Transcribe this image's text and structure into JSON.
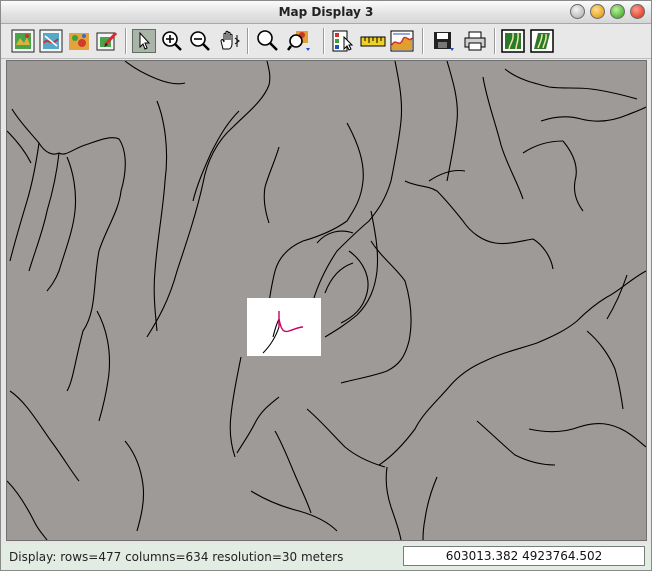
{
  "window": {
    "title": "Map Display 3"
  },
  "toolbar": {
    "buttons": [
      {
        "name": "display-raster-map-icon"
      },
      {
        "name": "display-vector-map-icon"
      },
      {
        "name": "display-shaded-relief-icon"
      },
      {
        "name": "overlay-icon"
      },
      {
        "name": "pointer-icon"
      },
      {
        "name": "zoom-in-icon"
      },
      {
        "name": "zoom-out-icon"
      },
      {
        "name": "pan-icon"
      },
      {
        "name": "zoom-menu-icon"
      },
      {
        "name": "query-icon"
      },
      {
        "name": "layer-legend-icon"
      },
      {
        "name": "measure-icon"
      },
      {
        "name": "profile-icon"
      },
      {
        "name": "save-icon"
      },
      {
        "name": "print-icon"
      },
      {
        "name": "mode-2d-icon"
      },
      {
        "name": "mode-3d-icon"
      }
    ]
  },
  "status": {
    "display_info": "Display: rows=477 columns=634  resolution=30 meters",
    "coordinates": "603013.382 4923764.502"
  },
  "colors": {
    "map_background": "#9e9a98",
    "stream_lines": "#000000",
    "highlight_stream": "#cc0066",
    "selection_box": "#ffffff"
  }
}
